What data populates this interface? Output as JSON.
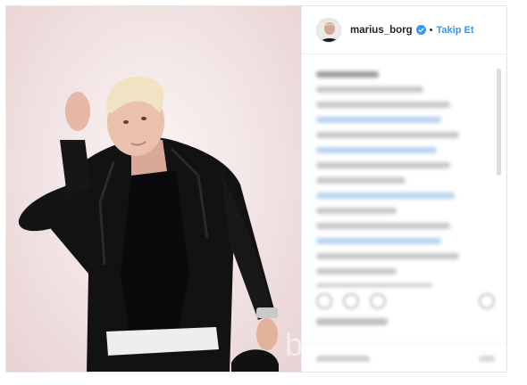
{
  "header": {
    "username": "marius_borg",
    "separator": "•",
    "follow_label": "Takip Et"
  },
  "colors": {
    "link_blue": "#3897f0",
    "verified_blue": "#3897f0",
    "text": "#262626",
    "border": "#efefef"
  },
  "icons": {
    "verified": "verified-badge-icon",
    "more": "more-options-icon"
  },
  "comments_blurred": true
}
